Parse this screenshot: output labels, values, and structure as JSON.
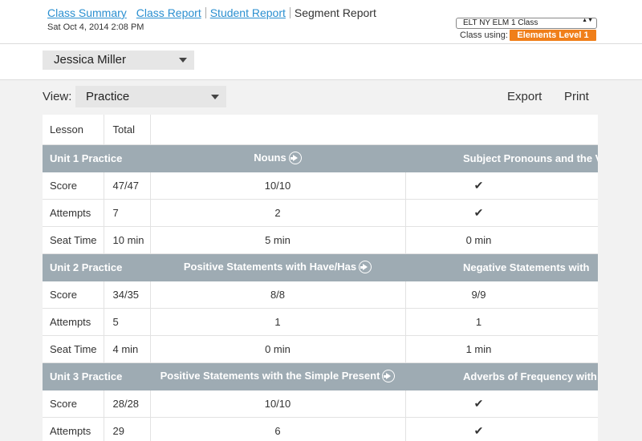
{
  "nav": {
    "class_summary": "Class Summary",
    "class_report": "Class Report",
    "student_report": "Student Report",
    "segment_report": "Segment Report",
    "timestamp": "Sat Oct 4, 2014 2:08 PM"
  },
  "class_select": {
    "value": "ELT NY ELM 1 Class",
    "arrows": "▲▼"
  },
  "class_using": {
    "label": "Class using:",
    "badge": "Elements Level 1",
    "badge_color": "#f07f1a"
  },
  "student_select": {
    "value": "Jessica Miller",
    "icon": "chevron-down-icon"
  },
  "view": {
    "label": "View:",
    "value": "Practice",
    "export": "Export",
    "print": "Print"
  },
  "table": {
    "headers": {
      "lesson": "Lesson",
      "total": "Total"
    },
    "check": "✔",
    "units": [
      {
        "name": "Unit 1 Practice",
        "lesson_a": "Nouns",
        "lesson_b": "Subject Pronouns and the V",
        "rows": [
          {
            "label": "Score",
            "total": "47/47",
            "a": "10/10",
            "b": "✔"
          },
          {
            "label": "Attempts",
            "total": "7",
            "a": "2",
            "b": "✔"
          },
          {
            "label": "Seat Time",
            "total": "10 min",
            "a": "5 min",
            "b": "0 min"
          }
        ]
      },
      {
        "name": "Unit 2 Practice",
        "lesson_a": "Positive Statements with Have/Has",
        "lesson_b": "Negative Statements with",
        "rows": [
          {
            "label": "Score",
            "total": "34/35",
            "a": "8/8",
            "b": "9/9"
          },
          {
            "label": "Attempts",
            "total": "5",
            "a": "1",
            "b": "1"
          },
          {
            "label": "Seat Time",
            "total": "4 min",
            "a": "0 min",
            "b": "1 min"
          }
        ]
      },
      {
        "name": "Unit 3 Practice",
        "lesson_a": "Positive Statements with the Simple Present",
        "lesson_b": "Adverbs of Frequency with the Sim",
        "rows": [
          {
            "label": "Score",
            "total": "28/28",
            "a": "10/10",
            "b": "✔"
          },
          {
            "label": "Attempts",
            "total": "29",
            "a": "6",
            "b": "✔"
          }
        ]
      }
    ]
  }
}
